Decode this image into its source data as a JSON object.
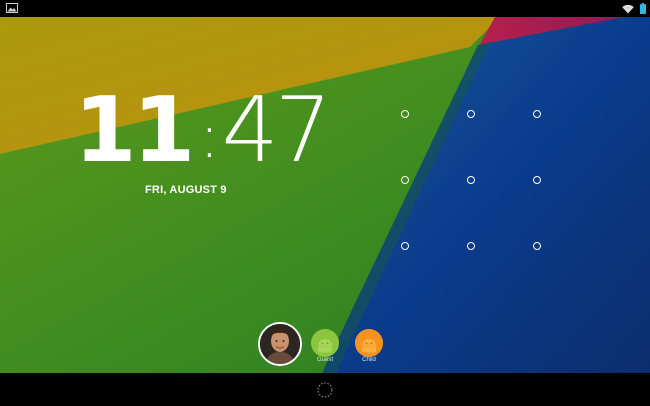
{
  "lockscreen": {
    "clock": {
      "hours": "11",
      "separator": ":",
      "minutes": "47"
    },
    "date": "FRI, AUGUST 9"
  },
  "users": [
    {
      "label": "",
      "kind": "current-user"
    },
    {
      "label": "Guest",
      "kind": "guest",
      "color": "#8cc63f"
    },
    {
      "label": "Child",
      "kind": "child",
      "color": "#f7931e"
    }
  ],
  "icons": {
    "status_left": "image-icon",
    "wifi": "wifi-icon",
    "battery": "battery-icon",
    "nav_center": "loading-spinner-icon"
  },
  "colors": {
    "wallpaper_yellow": "#b89a08",
    "wallpaper_green": "#3d8a1f",
    "wallpaper_blue": "#0a3a88",
    "wallpaper_red": "#c0204a",
    "battery": "#33b5e5"
  }
}
